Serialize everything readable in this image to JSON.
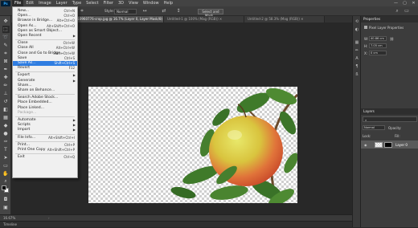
{
  "menubar": {
    "app_logo": "Ps",
    "items": [
      "File",
      "Edit",
      "Image",
      "Layer",
      "Type",
      "Select",
      "Filter",
      "3D",
      "View",
      "Window",
      "Help"
    ],
    "window_controls": [
      "—",
      "▢",
      "✕"
    ]
  },
  "options_bar": {
    "style_label": "Style:",
    "style_value": "Normal",
    "select_mask_button": "Select and Mask..."
  },
  "tabs": [
    {
      "label": "ayer Mask/8) ✕",
      "active": false
    },
    {
      "label": "AdobeStock_210960776-crop.jpg @ 16.7% (Layer 0, Layer Mask/8) ✕",
      "active": true
    },
    {
      "label": "Untitled-1 @ 100% (Mag (RGB)) ✕",
      "active": false
    },
    {
      "label": "Untitled-2 @ 58.3% (Mag (RGB)) ✕",
      "active": false
    }
  ],
  "file_menu": {
    "items": [
      {
        "label": "New...",
        "shortcut": "Ctrl+N"
      },
      {
        "label": "Open...",
        "shortcut": "Ctrl+O"
      },
      {
        "label": "Browse in Bridge...",
        "shortcut": "Alt+Ctrl+O"
      },
      {
        "label": "Open As...",
        "shortcut": "Alt+Shift+Ctrl+O"
      },
      {
        "label": "Open as Smart Object...",
        "shortcut": ""
      },
      {
        "label": "Open Recent",
        "shortcut": "",
        "submenu": true
      },
      {
        "sep": true
      },
      {
        "label": "Close",
        "shortcut": "Ctrl+W"
      },
      {
        "label": "Close All",
        "shortcut": "Alt+Ctrl+W"
      },
      {
        "label": "Close and Go to Bridge...",
        "shortcut": "Shift+Ctrl+W"
      },
      {
        "label": "Save",
        "shortcut": "Ctrl+S"
      },
      {
        "label": "Save As...",
        "shortcut": "Shift+Ctrl+S",
        "hover": true
      },
      {
        "label": "Revert",
        "shortcut": "F12"
      },
      {
        "sep": true
      },
      {
        "label": "Export",
        "shortcut": "",
        "submenu": true
      },
      {
        "label": "Generate",
        "shortcut": "",
        "submenu": true
      },
      {
        "label": "Share...",
        "shortcut": ""
      },
      {
        "label": "Share on Behance...",
        "shortcut": ""
      },
      {
        "sep": true
      },
      {
        "label": "Search Adobe Stock...",
        "shortcut": ""
      },
      {
        "label": "Place Embedded...",
        "shortcut": ""
      },
      {
        "label": "Place Linked...",
        "shortcut": ""
      },
      {
        "label": "Package...",
        "shortcut": "",
        "disabled": true
      },
      {
        "sep": true
      },
      {
        "label": "Automate",
        "shortcut": "",
        "submenu": true
      },
      {
        "label": "Scripts",
        "shortcut": "",
        "submenu": true
      },
      {
        "label": "Import",
        "shortcut": "",
        "submenu": true
      },
      {
        "sep": true
      },
      {
        "label": "File Info...",
        "shortcut": "Alt+Shift+Ctrl+I"
      },
      {
        "sep": true
      },
      {
        "label": "Print...",
        "shortcut": "Ctrl+P"
      },
      {
        "label": "Print One Copy",
        "shortcut": "Alt+Shift+Ctrl+P"
      },
      {
        "sep": true
      },
      {
        "label": "Exit",
        "shortcut": "Ctrl+Q"
      }
    ]
  },
  "status_bar": {
    "zoom": "16.67%"
  },
  "timeline_label": "Timeline",
  "properties_panel": {
    "tab": "Properties",
    "subtitle": "Pixel Layer Properties",
    "w_label": "W:",
    "w_value": "40.86 cm",
    "h_label": "H:",
    "h_value": "7.05 cm",
    "x_label": "X:",
    "x_value": "0 cm"
  },
  "layers_panel": {
    "tab": "Layers",
    "blend_mode": "Normal",
    "opacity_label": "Opacity:",
    "lock_label": "Lock:",
    "fill_label": "Fill:",
    "layer_name": "Layer 0"
  },
  "colors": {
    "accent": "#2f7de1",
    "canvas_bg": "#282828"
  }
}
